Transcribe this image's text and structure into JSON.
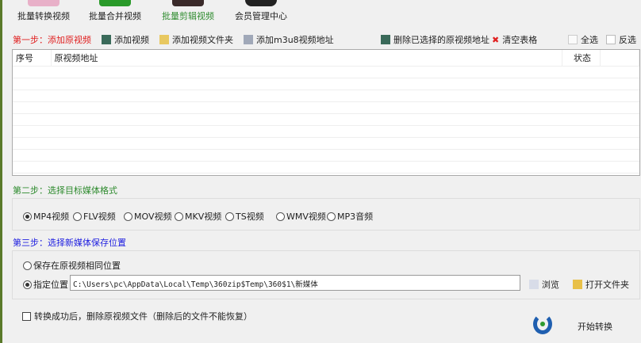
{
  "topnav": [
    {
      "label": "批量转换视频",
      "color": "#222222"
    },
    {
      "label": "批量合并视频",
      "color": "#222222"
    },
    {
      "label": "批量剪辑视频",
      "color": "#2e8b2e"
    },
    {
      "label": "会员管理中心",
      "color": "#222222"
    }
  ],
  "step1": {
    "title": "第一步：添加原视频",
    "add_video": "添加视频",
    "add_folder": "添加视频文件夹",
    "add_m3u8": "添加m3u8视频地址",
    "delete_selected": "删除已选择的原视频地址",
    "clear_table": "清空表格",
    "select_all": "全选",
    "invert": "反选"
  },
  "table": {
    "columns": [
      "序号",
      "原视频地址",
      "状态"
    ],
    "rows": []
  },
  "step2": {
    "title": "第二步：选择目标媒体格式",
    "formats": [
      "MP4视频",
      "FLV视频",
      "MOV视频",
      "MKV视频",
      "TS视频",
      "WMV视频",
      "MP3音频"
    ],
    "selected": "MP4视频"
  },
  "step3": {
    "title": "第三步：选择新媒体保存位置",
    "same_location": "保存在原视频相同位置",
    "custom_location": "指定位置",
    "path": "C:\\Users\\pc\\AppData\\Local\\Temp\\360zip$Temp\\360$1\\新媒体",
    "browse": "浏览",
    "open_folder": "打开文件夹"
  },
  "delete_after": "转换成功后，删除原视频文件（删除后的文件不能恢复）",
  "start": "开始转换",
  "colors": {
    "step1": "#e02020",
    "step2": "#2e8b2e",
    "step3": "#2020e0"
  }
}
